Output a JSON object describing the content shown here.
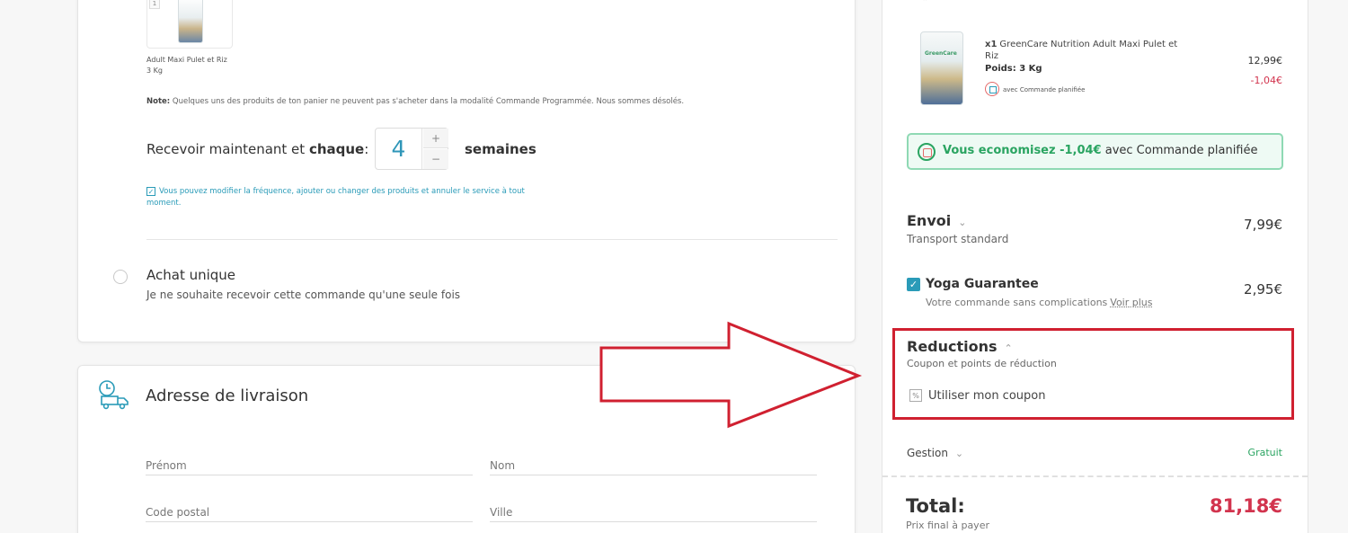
{
  "order": {
    "item_index": "1",
    "product_name_line1": "Adult Maxi Pulet et Riz",
    "product_weight": "3 Kg",
    "note_label": "Note:",
    "note_text": "Quelques uns des produits de ton panier ne peuvent pas s'acheter dans la modalité Commande Programmée. Nous sommes désolés.",
    "receive_prefix": "Recevoir maintenant et",
    "receive_bold": "chaque",
    "receive_colon": ":",
    "frequency_value": "4",
    "stepper_plus": "+",
    "stepper_minus": "−",
    "weeks_label": "semaines",
    "info_text": "Vous pouvez modifier la fréquence, ajouter ou changer des produits et annuler le service à tout moment.",
    "one_time_title": "Achat unique",
    "one_time_desc": "Je ne souhaite recevoir cette commande qu'une seule fois"
  },
  "address": {
    "title": "Adresse de livraison",
    "fields": {
      "first_name": "Prénom",
      "last_name": "Nom",
      "postal_code": "Code postal",
      "city": "Ville"
    }
  },
  "summary": {
    "top_glyph": "»",
    "bag_label": "GreenCare",
    "item_qty": "x1",
    "item_name": "GreenCare Nutrition Adult Maxi Pulet et Riz",
    "item_weight": "Poids: 3 Kg",
    "item_plan": "avec Commande planifiée",
    "item_price": "12,99€",
    "item_discount": "-1,04€",
    "savings_prefix": "Vous economisez -1,04€",
    "savings_suffix": " avec Commande planifiée",
    "shipping_title": "Envoi",
    "shipping_sub": "Transport standard",
    "shipping_price": "7,99€",
    "guarantee_title": "Yoga Guarantee",
    "guarantee_sub": "Votre commande sans complications",
    "guarantee_link": "Voir plus",
    "guarantee_price": "2,95€",
    "reductions_title": "Reductions",
    "reductions_sub": "Coupon et points de réduction",
    "coupon_label": "Utiliser mon coupon",
    "gestion_label": "Gestion",
    "gestion_value": "Gratuit",
    "total_label": "Total:",
    "total_value": "81,18€",
    "total_sub": "Prix final à payer"
  },
  "colors": {
    "accent": "#2a9bb8",
    "price_red": "#d2344e",
    "savings_green": "#2aa461",
    "annotation_red": "#d02030"
  }
}
